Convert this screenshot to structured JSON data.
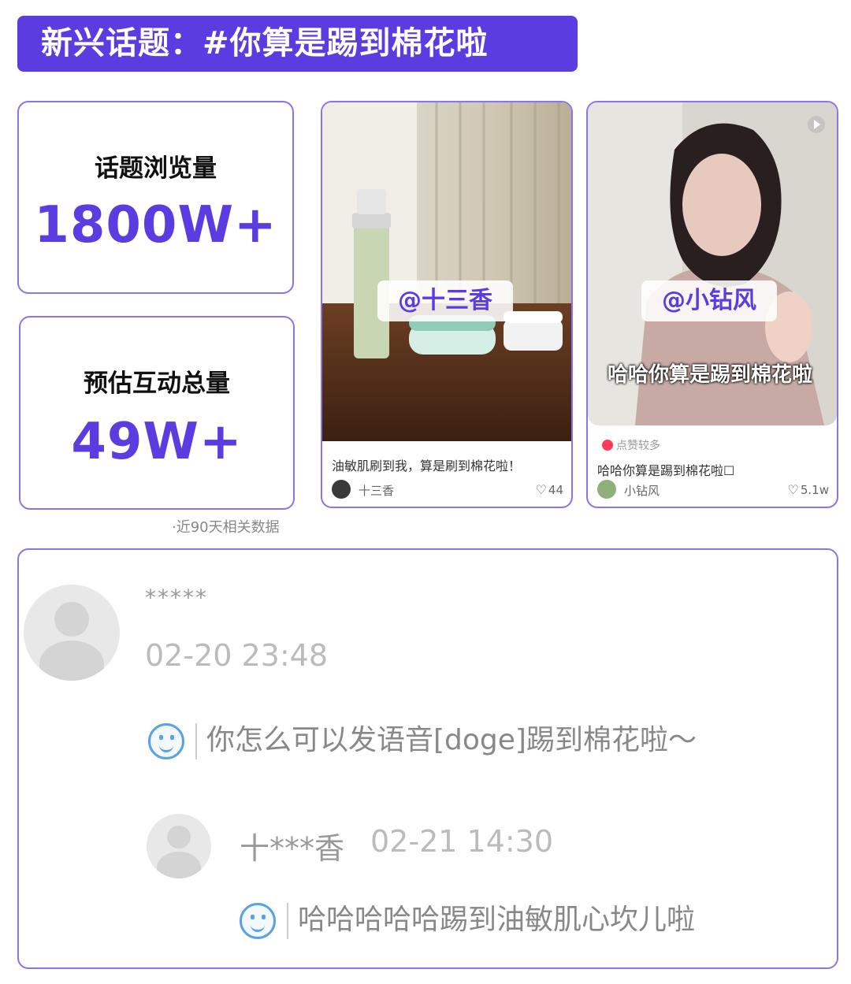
{
  "header": {
    "title": "新兴话题：#你算是踢到棉花啦"
  },
  "stats": [
    {
      "label": "话题浏览量",
      "value": "1800W+"
    },
    {
      "label": "预估互动总量",
      "value": "49W+"
    }
  ],
  "stats_note": "·近90天相关数据",
  "posts": [
    {
      "tag": "@十三香",
      "description": "油敏肌刷到我，算是刷到棉花啦！",
      "author": "十三香",
      "likes": "44"
    },
    {
      "tag": "@小钻风",
      "overlay_caption": "哈哈你算是踢到棉花啦",
      "badge": "点赞较多",
      "description": "哈哈你算是踢到棉花啦☐",
      "author": "小钻风",
      "likes": "5.1w"
    }
  ],
  "comment": {
    "user": "*****",
    "time": "02-20 23:48",
    "text": "你怎么可以发语音[doge]踢到棉花啦～",
    "reply": {
      "user": "十***香",
      "time": "02-21 14:30",
      "text": "哈哈哈哈哈踢到油敏肌心坎儿啦"
    }
  },
  "colors": {
    "accent": "#5a3ce0",
    "border": "#8a74ee"
  },
  "icons": [
    "heart-icon",
    "smile-emoji-icon",
    "avatar-placeholder-icon",
    "hot-badge-icon"
  ]
}
